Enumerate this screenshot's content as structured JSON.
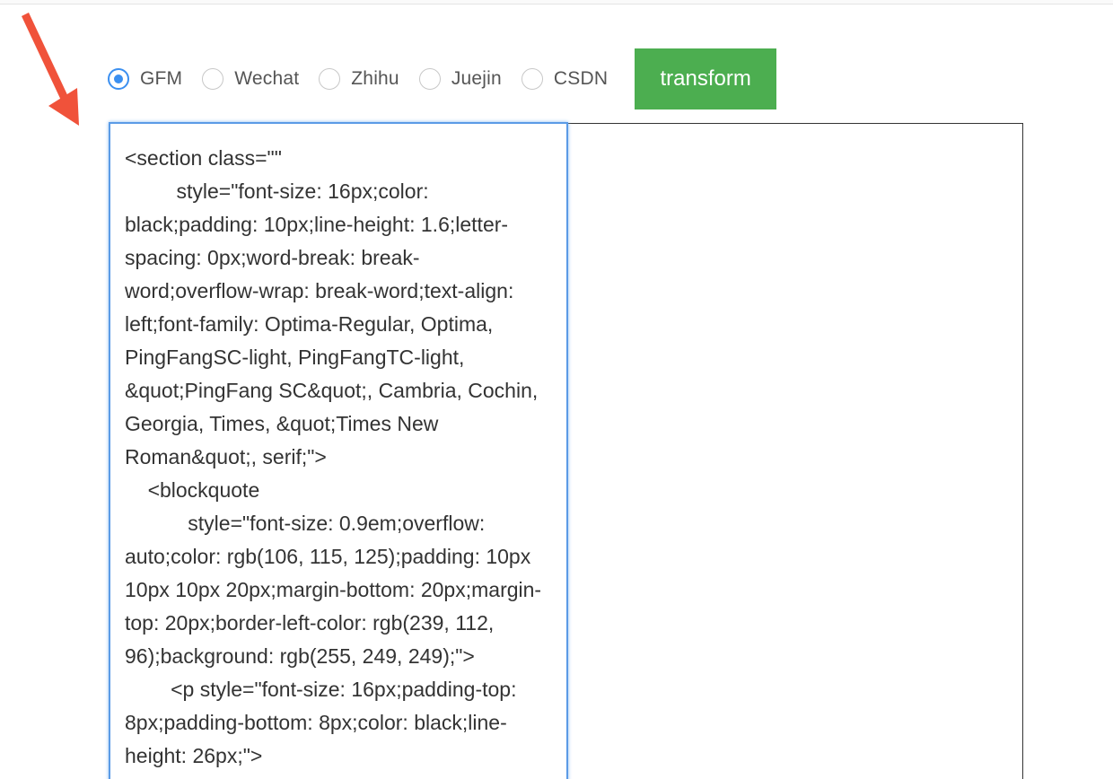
{
  "format_options": [
    {
      "label": "GFM",
      "checked": true
    },
    {
      "label": "Wechat",
      "checked": false
    },
    {
      "label": "Zhihu",
      "checked": false
    },
    {
      "label": "Juejin",
      "checked": false
    },
    {
      "label": "CSDN",
      "checked": false
    }
  ],
  "transform_button": {
    "label": "transform"
  },
  "editor": {
    "content": "<section class=\"\"\n         style=\"font-size: 16px;color: black;padding: 10px;line-height: 1.6;letter-spacing: 0px;word-break: break-word;overflow-wrap: break-word;text-align: left;font-family: Optima-Regular, Optima, PingFangSC-light, PingFangTC-light, &quot;PingFang SC&quot;, Cambria, Cochin, Georgia, Times, &quot;Times New Roman&quot;, serif;\">\n    <blockquote\n           style=\"font-size: 0.9em;overflow: auto;color: rgb(106, 115, 125);padding: 10px 10px 10px 20px;margin-bottom: 20px;margin-top: 20px;border-left-color: rgb(239, 112, 96);background: rgb(255, 249, 249);\">\n        <p style=\"font-size: 16px;padding-top: 8px;padding-bottom: 8px;color: black;line-height: 26px;\">"
  },
  "icons": {
    "annotation_arrow": "arrow-down-left-icon",
    "arrow_color": "#f0523a"
  },
  "colors": {
    "accent": "#3b8ff0",
    "button": "#4cae50"
  }
}
